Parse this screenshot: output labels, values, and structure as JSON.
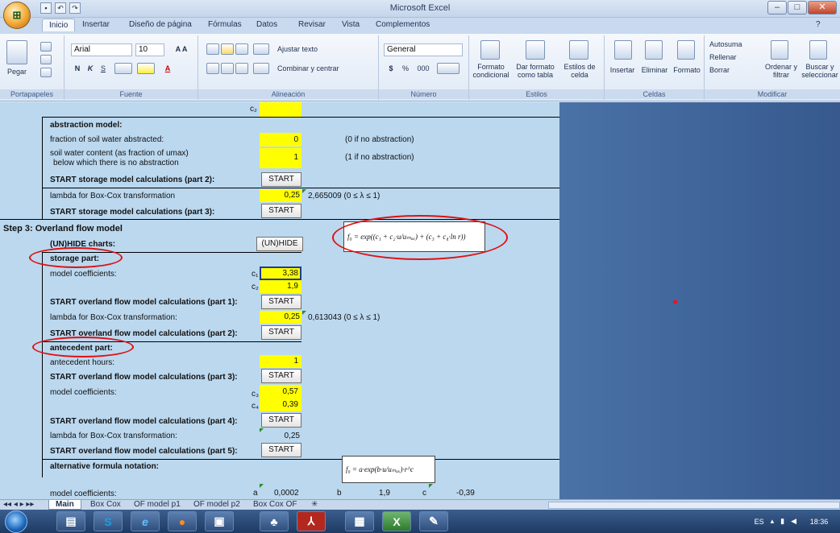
{
  "window": {
    "title": "Microsoft Excel",
    "office_logo": "office-logo"
  },
  "ribbon_tabs": [
    "Inicio",
    "Insertar",
    "Diseño de página",
    "Fórmulas",
    "Datos",
    "Revisar",
    "Vista",
    "Complementos"
  ],
  "ribbon": {
    "clipboard": {
      "paste": "Pegar",
      "label": "Portapapeles"
    },
    "font": {
      "name": "Arial",
      "size": "10",
      "bold": "N",
      "italic": "K",
      "underline": "S",
      "label": "Fuente"
    },
    "alignment": {
      "wrap": "Ajustar texto",
      "merge": "Combinar y centrar",
      "label": "Alineación"
    },
    "number": {
      "format": "General",
      "currency": "$",
      "percent": "%",
      "thousands": "000",
      "label": "Número"
    },
    "styles": {
      "cond": "Formato condicional",
      "table": "Dar formato como tabla",
      "cell": "Estilos de celda",
      "label": "Estilos"
    },
    "cells": {
      "insert": "Insertar",
      "delete": "Eliminar",
      "format": "Formato",
      "label": "Celdas"
    },
    "editing": {
      "autosum": "Autosuma",
      "fill": "Rellenar",
      "clear": "Borrar",
      "sort": "Ordenar y filtrar",
      "find": "Buscar y seleccionar",
      "label": "Modificar"
    }
  },
  "sheet": {
    "c2_top": "c₂",
    "abstraction_title": "abstraction model:",
    "abs_frac_label": "fraction of soil water abstracted:",
    "abs_frac_value": "0",
    "abs_frac_note": "(0 if no abstraction)",
    "soil_label1": "soil water content (as fraction of umax)",
    "soil_label2": "below which there is no abstraction",
    "soil_value": "1",
    "soil_note": "(1 if no abstraction)",
    "start_storage2": "START storage model calculations (part 2):",
    "lambda_label": "lambda for Box-Cox transformation",
    "lambda1_value": "0,25",
    "lambda1_note": "2,665009 (0 ≤ λ ≤ 1)",
    "start_storage3": "START storage model calculations (part 3):",
    "step3_title": "Step 3: Overland flow model",
    "unhide_label": "(UN)HIDE charts:",
    "unhide_btn": "(UN)HIDE",
    "storage_part": "storage part:",
    "model_coeff": "model coefficients:",
    "c1": "c₁",
    "c1_value": "3,38",
    "c2": "c₂",
    "c2_value": "1,9",
    "start_of1": "START overland flow model calculations (part 1):",
    "lambda2_label": "lambda for Box-Cox transformation:",
    "lambda2_value": "0,25",
    "lambda2_note": "0,613043 (0 ≤ λ ≤ 1)",
    "start_of2": "START overland flow model calculations (part 2):",
    "antecedent_part": "antecedent part:",
    "antecedent_hours": "antecedent hours:",
    "antecedent_value": "1",
    "start_of3": "START overland flow model calculations (part 3):",
    "model_coeff2": "model coefficients:",
    "c3": "c₃",
    "c3_value": "0,57",
    "c4": "c₄",
    "c4_value": "0,39",
    "start_of4": "START overland flow model calculations (part 4):",
    "lambda3_label": "lambda for Box-Cox transformation:",
    "lambda3_value": "0,25",
    "start_of5": "START overland flow model calculations (part 5):",
    "alt_formula": "alternative formula notation:",
    "model_coeff3": "model coefficients:",
    "a_label": "a",
    "a_value": "0,0002",
    "b_label": "b",
    "b_value": "1,9",
    "c_label": "c",
    "c_value": "-0,39",
    "start_btn": "START"
  },
  "sheet_tabs": [
    "Main",
    "Box Cox",
    "OF model p1",
    "OF model p2",
    "Box Cox OF"
  ],
  "taskbar": {
    "lang": "ES",
    "time": "18:36"
  }
}
